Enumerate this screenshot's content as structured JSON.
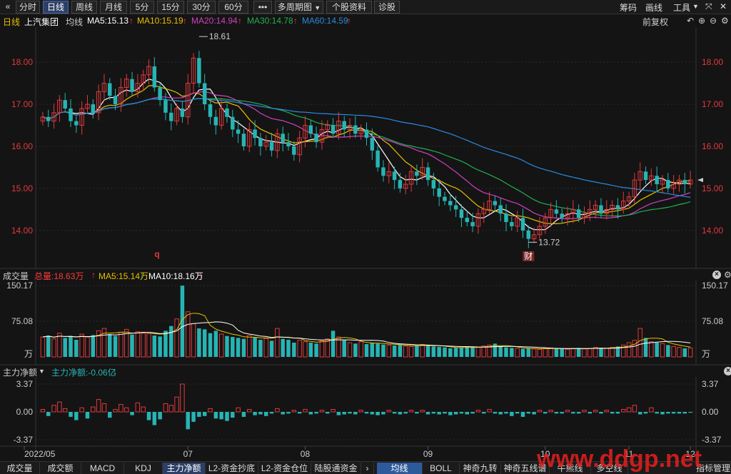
{
  "toolbar": {
    "back_glyph": "«",
    "periods": [
      "分时",
      "日线",
      "周线",
      "月线",
      "5分",
      "15分",
      "30分",
      "60分"
    ],
    "active_period": "日线",
    "more": "•••",
    "multi_period": "多周期图",
    "stock_info": "个股资料",
    "diagnose": "诊股",
    "right_items": [
      "筹码",
      "画线",
      "工具"
    ]
  },
  "info": {
    "period": "日线",
    "stock_name": "上汽集团",
    "avg_label": "均线",
    "ma5": "MA5:15.13",
    "ma10": "MA10:15.19",
    "ma20": "MA20:14.94",
    "ma30": "MA30:14.78",
    "ma60": "MA60:14.59",
    "adjust": "前复权"
  },
  "volume_bar": {
    "title": "成交量",
    "total": "总量:18.63万",
    "ma5": "MA5:15.14万",
    "ma10": "MA10:18.16万"
  },
  "flow_bar": {
    "title": "主力净额",
    "value": "主力净额:-0.06亿"
  },
  "bottom_tabs": [
    "成交量",
    "成交额",
    "MACD",
    "KDJ",
    "主力净额",
    "L2-资金抄底",
    "L2-资金仓位",
    "陆股通资金"
  ],
  "bottom_active": "主力净额",
  "bottom_right_tabs": [
    "均线",
    "BOLL",
    "神奇九转",
    "神奇五线谱",
    "牛熊线",
    "多空线",
    "指标管理"
  ],
  "bottom_right_active": "均线",
  "watermark": "www.ddgp.net",
  "markers": {
    "q": "q",
    "cai": "财"
  },
  "colors": {
    "up": "#e0393e",
    "down": "#27b4b4",
    "ma5": "#ffffff",
    "ma10": "#e8c000",
    "ma20": "#d040c0",
    "ma30": "#20b050",
    "ma60": "#2a8ae0",
    "accent": "#ff3b3b"
  },
  "chart_data": [
    {
      "type": "candlestick",
      "title": "上汽集团 日线",
      "x_labels": [
        "2022/05",
        "07",
        "08",
        "09",
        "10",
        "11",
        "12"
      ],
      "ylim": [
        13.2,
        18.8
      ],
      "yticks": [
        "18.00",
        "17.00",
        "16.00",
        "15.00",
        "14.00"
      ],
      "annotations": {
        "high": "18.61",
        "low": "13.72"
      },
      "series": [
        {
          "name": "MA5",
          "value": 15.13
        },
        {
          "name": "MA10",
          "value": 15.19
        },
        {
          "name": "MA20",
          "value": 14.94
        },
        {
          "name": "MA30",
          "value": 14.78
        },
        {
          "name": "MA60",
          "value": 14.59
        }
      ],
      "closes": [
        16.7,
        16.6,
        16.8,
        17.1,
        16.9,
        16.6,
        16.5,
        16.9,
        17.0,
        16.8,
        17.3,
        17.5,
        17.2,
        17.0,
        17.4,
        17.6,
        17.3,
        17.5,
        17.7,
        17.9,
        17.4,
        17.1,
        16.8,
        16.6,
        16.9,
        16.7,
        17.5,
        18.1,
        17.5,
        17.0,
        16.7,
        16.5,
        16.9,
        16.7,
        16.4,
        16.3,
        16.0,
        16.4,
        16.2,
        16.0,
        16.1,
        15.9,
        16.3,
        16.1,
        16.0,
        15.8,
        16.2,
        16.5,
        16.3,
        16.1,
        16.4,
        16.5,
        16.3,
        16.6,
        16.4,
        16.5,
        16.3,
        16.4,
        16.2,
        15.9,
        15.5,
        15.3,
        15.4,
        15.2,
        15.0,
        15.1,
        15.4,
        15.3,
        15.5,
        15.2,
        15.0,
        14.8,
        14.7,
        14.6,
        14.5,
        14.3,
        14.2,
        14.1,
        14.4,
        14.5,
        14.7,
        14.6,
        14.4,
        14.2,
        14.1,
        14.3,
        14.0,
        13.8,
        13.9,
        14.1,
        14.3,
        14.5,
        14.4,
        14.3,
        14.4,
        14.5,
        14.3,
        14.4,
        14.5,
        14.6,
        14.4,
        14.5,
        14.6,
        14.5,
        14.7,
        14.8,
        15.2,
        15.4,
        15.2,
        15.3,
        15.1,
        15.2,
        15.0,
        15.1,
        15.2,
        15.1,
        15.2
      ],
      "volumes": [
        42,
        45,
        38,
        50,
        40,
        44,
        36,
        48,
        42,
        46,
        55,
        60,
        48,
        44,
        52,
        58,
        47,
        53,
        50,
        49,
        45,
        43,
        55,
        65,
        80,
        150,
        95,
        70,
        60,
        58,
        50,
        55,
        48,
        44,
        42,
        40,
        38,
        45,
        42,
        36,
        39,
        34,
        60,
        38,
        36,
        30,
        35,
        32,
        30,
        28,
        34,
        38,
        55,
        42,
        35,
        30,
        28,
        32,
        27,
        30,
        28,
        26,
        25,
        24,
        26,
        23,
        22,
        24,
        26,
        25,
        22,
        21,
        20,
        18,
        19,
        20,
        22,
        21,
        20,
        23,
        25,
        28,
        22,
        20,
        19,
        18,
        17,
        18,
        17,
        16,
        18,
        19,
        18,
        17,
        16,
        18,
        19,
        17,
        18,
        20,
        19,
        18,
        20,
        22,
        25,
        30,
        35,
        60,
        40,
        32,
        30,
        28,
        25,
        22,
        20,
        18,
        19
      ],
      "flows": [
        0.3,
        -0.5,
        0.8,
        1.2,
        0.4,
        -0.6,
        -1.0,
        0.5,
        -0.8,
        0.6,
        1.5,
        1.0,
        -0.7,
        0.3,
        0.9,
        0.5,
        -0.4,
        1.1,
        0.6,
        -1.0,
        -1.6,
        -0.9,
        1.0,
        0.8,
        1.8,
        3.37,
        -2.1,
        -1.2,
        -0.6,
        -0.5,
        0.4,
        -0.8,
        -0.9,
        -1.1,
        -0.7,
        0.5,
        -0.6,
        0.3,
        -0.4,
        -0.3,
        -0.5,
        -0.2,
        0.4,
        -0.3,
        -0.2,
        0.2,
        -0.2,
        0.3,
        -0.3,
        -0.2,
        0.2,
        -0.2,
        0.3,
        -0.4,
        -0.3,
        -0.2,
        -0.3,
        0.2,
        -0.2,
        -0.3,
        -0.4,
        -0.3,
        0.2,
        -0.2,
        -0.3,
        -0.2,
        0.2,
        -0.2,
        0.2,
        -0.3,
        -0.2,
        -0.3,
        -0.2,
        -0.4,
        -0.3,
        -0.2,
        -0.3,
        -0.2,
        0.2,
        -0.2,
        0.3,
        -0.2,
        -0.3,
        -0.2,
        -0.5,
        -0.2,
        -0.6,
        -0.2,
        -0.3,
        0.2,
        -0.2,
        0.2,
        -0.2,
        -0.2,
        0.2,
        -0.2,
        -0.2,
        0.2,
        -0.2,
        0.2,
        -0.2,
        0.2,
        -0.2,
        -0.2,
        0.3,
        0.5,
        0.8,
        -0.3,
        -0.2,
        0.5,
        -0.2,
        -0.3,
        -0.2,
        -0.2,
        -0.2,
        -0.2,
        -0.1
      ]
    },
    {
      "type": "bar",
      "title": "成交量",
      "ylim": [
        0,
        150.17
      ],
      "yticks": [
        "150.17",
        "75.08"
      ],
      "unit": "万"
    },
    {
      "type": "bar",
      "title": "主力净额",
      "ylim": [
        -3.37,
        3.37
      ],
      "yticks": [
        "3.37",
        "0.00",
        "-3.37"
      ]
    }
  ]
}
